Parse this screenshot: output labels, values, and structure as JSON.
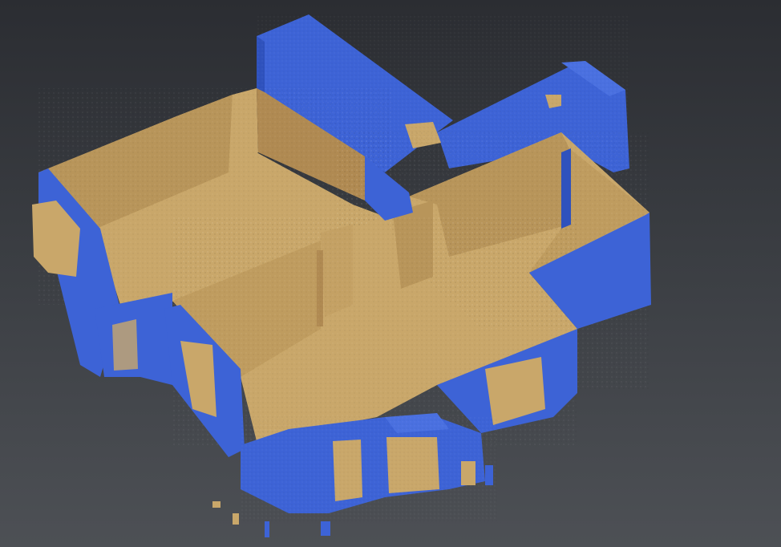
{
  "viewport": {
    "scene": "point-cloud-floor-plan",
    "colors": {
      "interior": "#c9a76a",
      "interior_shadow": "#b8955a",
      "interior_dark": "#a8874f",
      "exterior": "#3d63d6",
      "exterior_light": "#4a70e0",
      "exterior_dark": "#2f52bd",
      "background_top": "#2b2d32",
      "background_bottom": "#4d5055"
    }
  }
}
